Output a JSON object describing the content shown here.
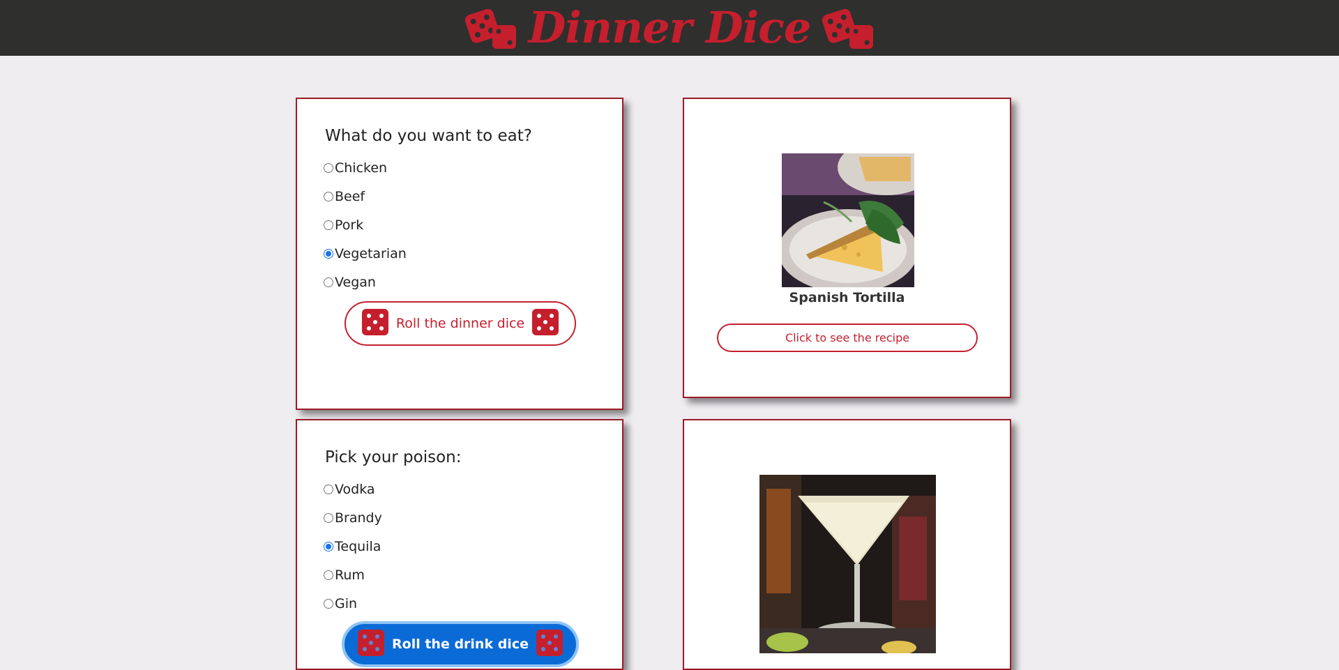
{
  "header": {
    "title": "Dinner Dice"
  },
  "colors": {
    "accent": "#c51f2d",
    "header_bg": "#2f2f2e",
    "page_bg": "#efedf0",
    "focus_blue": "#0b6bd6"
  },
  "food_card": {
    "question": "What do you want to eat?",
    "options": [
      {
        "label": "Chicken",
        "checked": false
      },
      {
        "label": "Beef",
        "checked": false
      },
      {
        "label": "Pork",
        "checked": false
      },
      {
        "label": "Vegetarian",
        "checked": true
      },
      {
        "label": "Vegan",
        "checked": false
      }
    ],
    "roll_label": "Roll the dinner dice"
  },
  "result_card": {
    "image_icon": "spanish-tortilla-photo",
    "dish_name": "Spanish Tortilla",
    "recipe_button": "Click to see the recipe"
  },
  "drink_card": {
    "question": "Pick your poison:",
    "options": [
      {
        "label": "Vodka",
        "checked": false
      },
      {
        "label": "Brandy",
        "checked": false
      },
      {
        "label": "Tequila",
        "checked": true
      },
      {
        "label": "Rum",
        "checked": false
      },
      {
        "label": "Gin",
        "checked": false
      }
    ],
    "roll_label": "Roll the drink dice"
  },
  "drink_result_card": {
    "image_icon": "cocktail-photo"
  }
}
